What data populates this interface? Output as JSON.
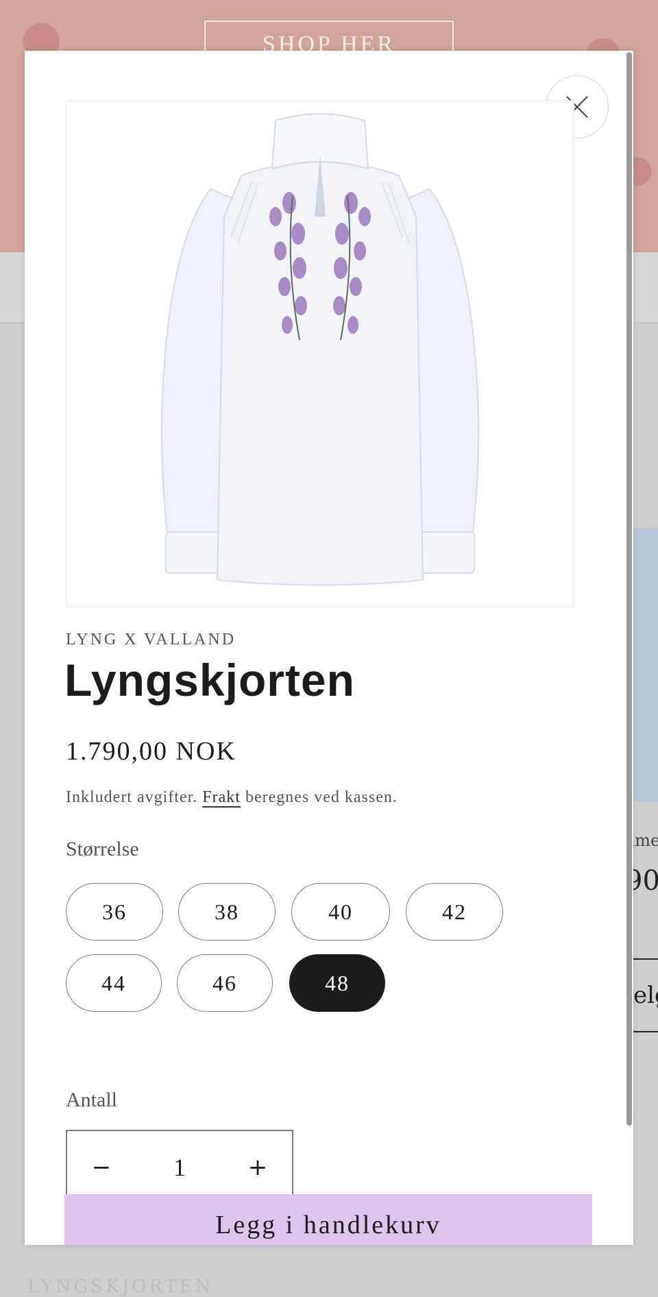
{
  "background": {
    "hero_button_label": "SHOP HER",
    "product_name_partial": "ame",
    "product_price_partial": "90",
    "select_button_partial": "elg",
    "footer_partial": "LYNGSKJORTEN"
  },
  "modal": {
    "close_icon": "close-icon",
    "product_image_alt": "Lyngskjorten",
    "vendor": "LYNG X VALLAND",
    "title": "Lyngskjorten",
    "price": "1.790,00 NOK",
    "tax_note_prefix": "Inkludert avgifter.",
    "tax_note_link": "Frakt",
    "tax_note_suffix": "beregnes ved kassen.",
    "size_label": "Størrelse",
    "sizes": [
      {
        "label": "36",
        "selected": false
      },
      {
        "label": "38",
        "selected": false
      },
      {
        "label": "40",
        "selected": false
      },
      {
        "label": "42",
        "selected": false
      },
      {
        "label": "44",
        "selected": false
      },
      {
        "label": "46",
        "selected": false
      },
      {
        "label": "48",
        "selected": true
      }
    ],
    "quantity_label": "Antall",
    "quantity_value": "1",
    "minus_symbol": "−",
    "plus_symbol": "+",
    "add_to_cart_label": "Legg i handlekurv",
    "add_to_cart_color": "#dcc6ee",
    "selected_size_color": "#1c1c1c"
  }
}
